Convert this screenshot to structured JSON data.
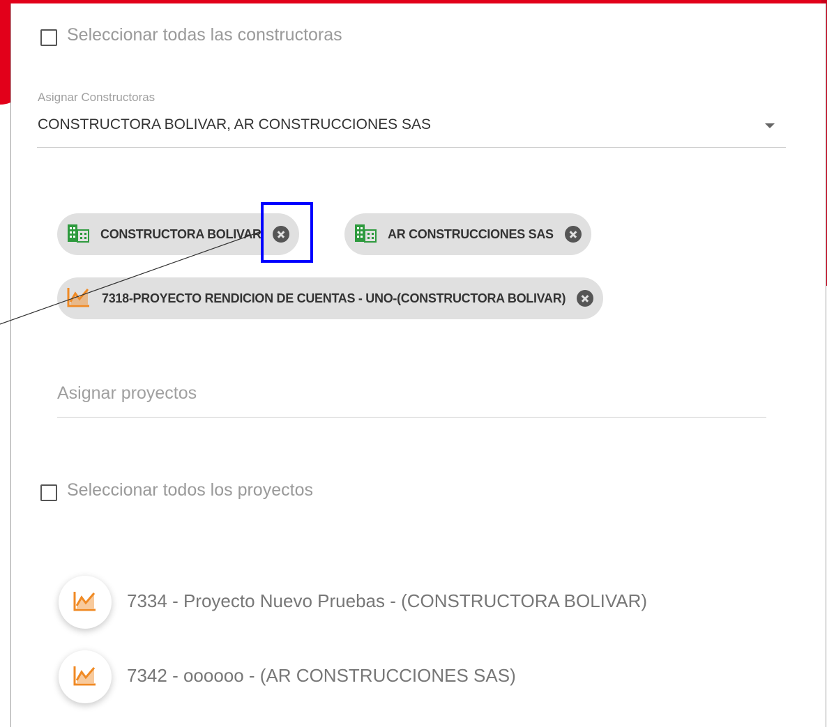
{
  "select_all_builders": {
    "label": "Seleccionar todas las constructoras"
  },
  "builders_select": {
    "label": "Asignar Constructoras",
    "value": "CONSTRUCTORA BOLIVAR, AR CONSTRUCCIONES SAS"
  },
  "chips": [
    {
      "label": "CONSTRUCTORA BOLIVAR",
      "icon": "building-icon"
    },
    {
      "label": "AR CONSTRUCCIONES SAS",
      "icon": "building-icon"
    },
    {
      "label": "7318-PROYECTO RENDICION DE CUENTAS - UNO-(CONSTRUCTORA BOLIVAR)",
      "icon": "chart-icon"
    }
  ],
  "projects_input": {
    "placeholder": "Asignar proyectos"
  },
  "select_all_projects": {
    "label": "Seleccionar todos los proyectos"
  },
  "projects": [
    {
      "label": "7334 - Proyecto Nuevo Pruebas - (CONSTRUCTORA BOLIVAR)",
      "icon": "chart-icon"
    },
    {
      "label": "7342 - oooooo - (AR CONSTRUCCIONES SAS)",
      "icon": "chart-icon"
    }
  ],
  "colors": {
    "accent_red": "#e2001a",
    "building_green": "#2e9a3e",
    "chart_orange": "#f08a24",
    "highlight_blue": "#0000ff"
  }
}
